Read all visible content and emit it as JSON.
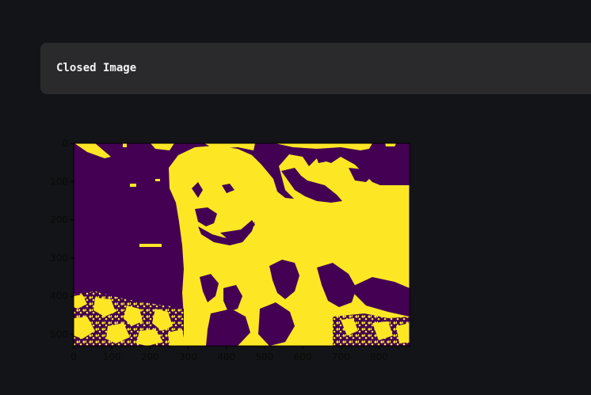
{
  "section": {
    "title": "Closed Image"
  },
  "image_axes": {
    "x_ticks": [
      "0",
      "100",
      "200",
      "300",
      "400",
      "500",
      "600",
      "700",
      "800"
    ],
    "y_ticks": [
      "0",
      "100",
      "200",
      "300",
      "400",
      "500"
    ],
    "x_tick_values": [
      0,
      100,
      200,
      300,
      400,
      500,
      600,
      700,
      800
    ],
    "y_tick_values": [
      0,
      100,
      200,
      300,
      400,
      500
    ],
    "xlim": [
      0,
      880
    ],
    "ylim": [
      530,
      0
    ],
    "colormap_background": "#440154",
    "colormap_foreground": "#fde725",
    "content": "binary closed image of a puppy on grass"
  },
  "colors": {
    "page_bg": "#131417",
    "header_bg": "#2a2a2d",
    "header_text": "#f2f2f2",
    "tick_text": "#0a0a0a"
  }
}
